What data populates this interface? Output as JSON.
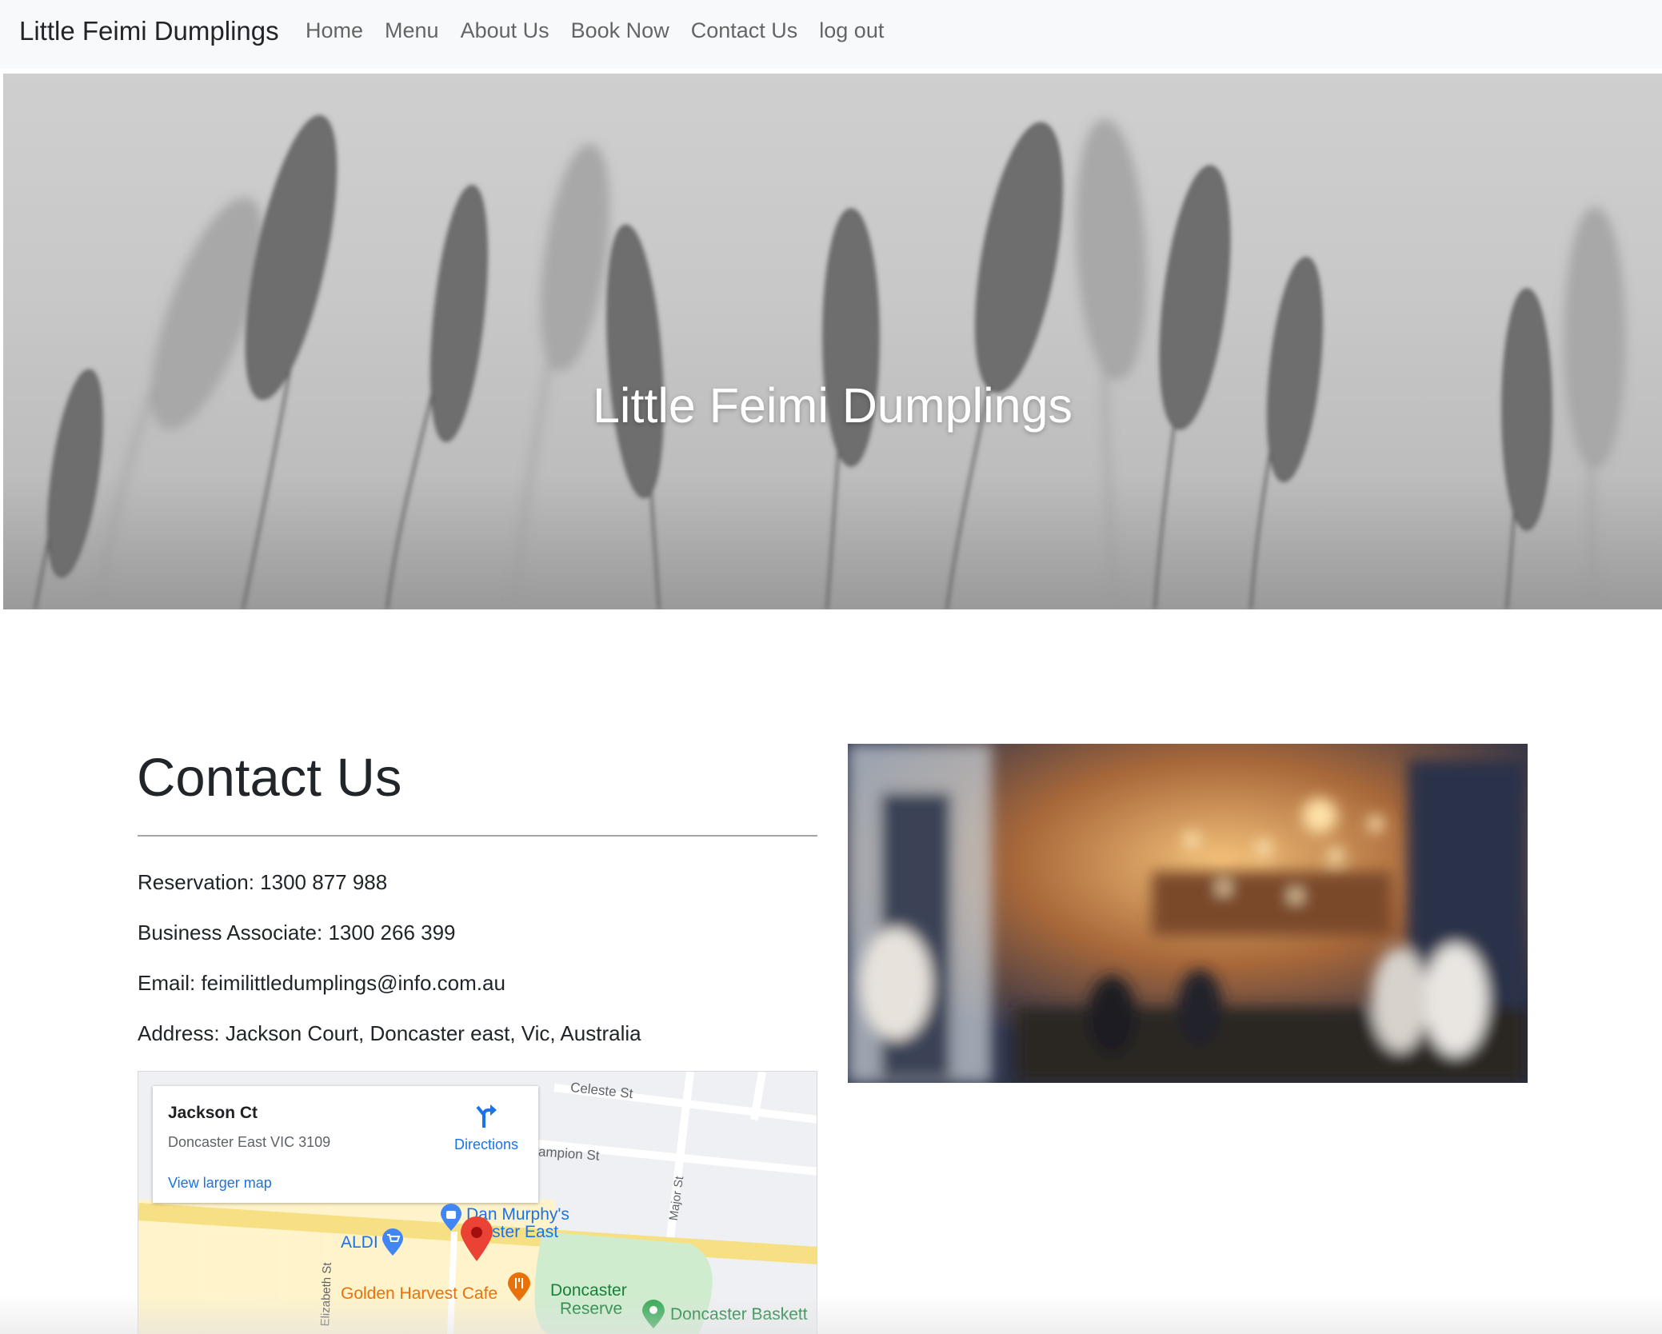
{
  "navbar": {
    "brand": "Little Feimi Dumplings",
    "links": [
      "Home",
      "Menu",
      "About Us",
      "Book Now",
      "Contact Us",
      "log out"
    ]
  },
  "hero": {
    "title": "Little Feimi Dumplings"
  },
  "contact": {
    "title": "Contact Us",
    "reservation": "Reservation: 1300 877 988",
    "business": "Business Associate: 1300 266 399",
    "email": "Email: feimilittledumplings@info.com.au",
    "address": "Address: Jackson Court, Doncaster east, Vic, Australia"
  },
  "map": {
    "place_name": "Jackson Ct",
    "place_address": "Doncaster East VIC 3109",
    "directions_label": "Directions",
    "larger_map_label": "View larger map",
    "labels": {
      "celeste": "Celeste St",
      "campion": "ampion St",
      "major": "Major St",
      "elizabeth": "Elizabeth St",
      "dan1": "Dan Murphy's",
      "dan2": "caster East",
      "aldi": "ALDI",
      "golden": "Golden Harvest Cafe",
      "reserve1": "Doncaster",
      "reserve2": "Reserve",
      "basket": "Doncaster Baskett"
    }
  },
  "colors": {
    "navbar_bg": "#f8f9fa",
    "link_blue": "#1a73e8",
    "pin_red": "#ea4335",
    "food_orange": "#e8710a",
    "park_green": "#34a853"
  }
}
